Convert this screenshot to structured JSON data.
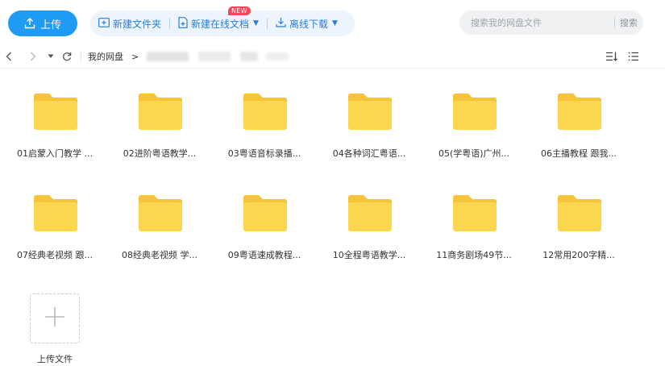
{
  "toolbar": {
    "upload_label": "上传",
    "new_folder_label": "新建文件夹",
    "new_online_doc_label": "新建在线文档",
    "new_badge": "NEW",
    "offline_download_label": "离线下载",
    "search_placeholder": "搜索我的网盘文件",
    "search_button": "搜索"
  },
  "breadcrumb": {
    "root": "我的网盘",
    "separator": ">"
  },
  "folders": [
    {
      "name": "01启蒙入门教学 ..."
    },
    {
      "name": "02进阶粤语教学..."
    },
    {
      "name": "03粤语音标录播..."
    },
    {
      "name": "04各种词汇粤语..."
    },
    {
      "name": "05(学粤语)广州..."
    },
    {
      "name": "06主播教程 跟我..."
    },
    {
      "name": "07经典老视频 跟..."
    },
    {
      "name": "08经典老视频 学..."
    },
    {
      "name": "09粤语速成教程..."
    },
    {
      "name": "10全程粤语教学..."
    },
    {
      "name": "11商务剧场49节..."
    },
    {
      "name": "12常用200字精..."
    }
  ],
  "upload_tile": {
    "label": "上传文件"
  },
  "colors": {
    "accent": "#1f9bf5",
    "folder": "#fdd64f",
    "folder_tab": "#f6c43a",
    "badge": "#f5465e"
  },
  "icons": {
    "upload": "upload-icon",
    "new_folder": "new-folder-icon",
    "new_doc": "new-doc-icon",
    "download": "download-icon",
    "back": "chevron-left-icon",
    "forward": "chevron-right-icon",
    "dropdown": "caret-down-icon",
    "refresh": "refresh-icon",
    "sort": "sort-icon",
    "list": "list-view-icon",
    "plus": "plus-icon"
  }
}
